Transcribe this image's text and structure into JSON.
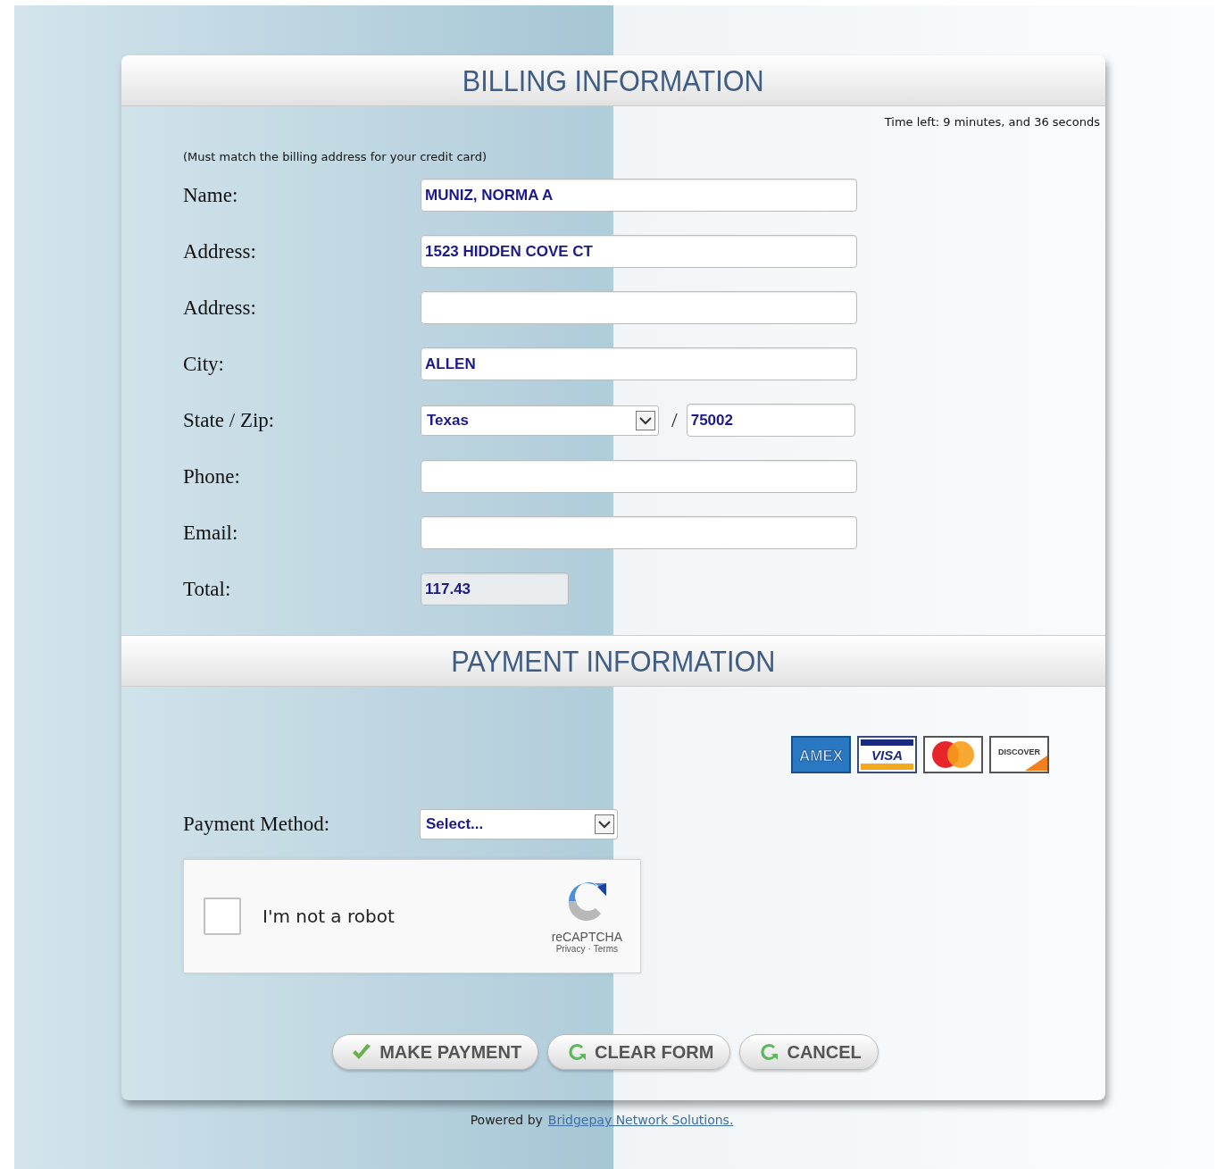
{
  "billing": {
    "title": "BILLING INFORMATION",
    "timer": "Time left: 9 minutes, and 36 seconds",
    "note": "(Must match the billing address for your credit card)",
    "fields": [
      {
        "label": "Name:",
        "kind": "text",
        "value": "MUNIZ, NORMA A",
        "disabled": false
      },
      {
        "label": "Address:",
        "kind": "text",
        "value": "1523 HIDDEN COVE CT",
        "disabled": false
      },
      {
        "label": "Address:",
        "kind": "text",
        "disabled": false
      },
      {
        "label": "City:",
        "kind": "text",
        "value": "ALLEN",
        "disabled": false
      },
      {
        "label": "State / Zip:",
        "kind": "state_zip",
        "value": "Texas",
        "separator": "/",
        "zip": "75002",
        "disabled": false
      },
      {
        "label": "Phone:",
        "kind": "text",
        "disabled": false
      },
      {
        "label": "Email:",
        "kind": "text",
        "disabled": false
      },
      {
        "label": "Total:",
        "kind": "short",
        "value": "117.43",
        "disabled": true
      }
    ]
  },
  "payment": {
    "title": "PAYMENT INFORMATION",
    "cards": [
      {
        "kind": "amex",
        "label": "AMEX"
      },
      {
        "kind": "visa",
        "label": "VISA"
      },
      {
        "kind": "mastercard"
      },
      {
        "kind": "discover",
        "label": "DISCOVER"
      }
    ],
    "method": {
      "label": "Payment Method:",
      "value": "Select..."
    },
    "captcha": {
      "label": "I'm not a robot",
      "checked": false,
      "brand": "reCAPTCHA",
      "links": [
        "Privacy",
        "Terms"
      ],
      "separator": "·"
    }
  },
  "buttons": [
    {
      "label": "MAKE PAYMENT",
      "kind": "submit"
    },
    {
      "label": "CLEAR FORM",
      "kind": "reset"
    },
    {
      "label": "CANCEL",
      "kind": "reset"
    }
  ],
  "footer": {
    "text": "Powered by",
    "link": "Bridgepay Network Solutions."
  }
}
